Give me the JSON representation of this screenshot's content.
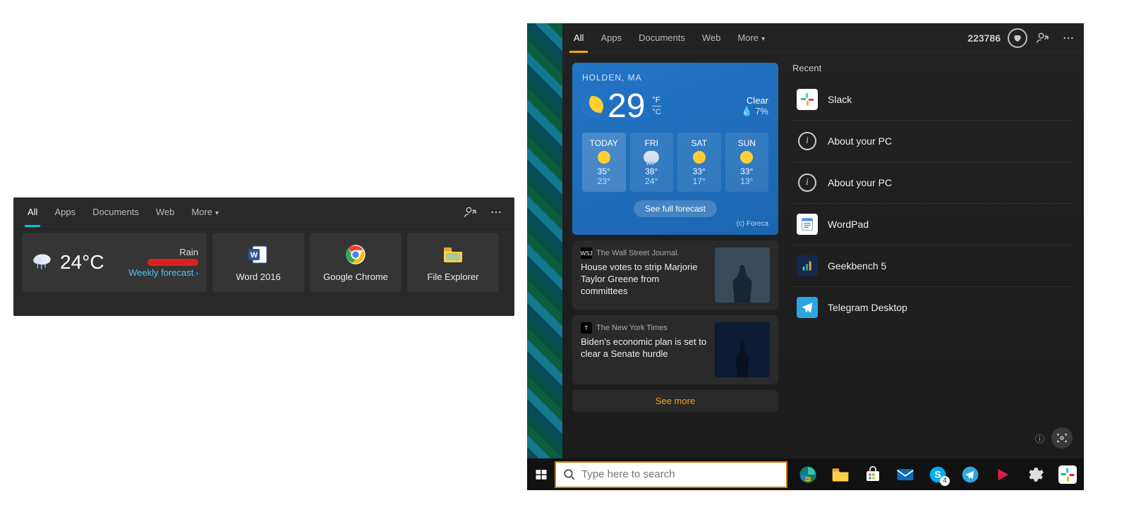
{
  "left": {
    "tabs": [
      "All",
      "Apps",
      "Documents",
      "Web",
      "More"
    ],
    "active_tab": 0,
    "weather": {
      "temp": "24°C",
      "condition": "Rain",
      "link": "Weekly forecast"
    },
    "apps": [
      {
        "name": "Word 2016",
        "key": "word"
      },
      {
        "name": "Google Chrome",
        "key": "chrome"
      },
      {
        "name": "File Explorer",
        "key": "explorer"
      }
    ]
  },
  "right": {
    "tabs": [
      "All",
      "Apps",
      "Documents",
      "Web",
      "More"
    ],
    "active_tab": 0,
    "points": "223786",
    "weather": {
      "location": "HOLDEN, MA",
      "temp": "29",
      "unit_f": "°F",
      "unit_c": "°C",
      "condition": "Clear",
      "humidity": "7%",
      "days": [
        {
          "label": "TODAY",
          "icon": "sun",
          "hi": "35°",
          "lo": "23°"
        },
        {
          "label": "FRI",
          "icon": "cloud",
          "hi": "38°",
          "lo": "24°"
        },
        {
          "label": "SAT",
          "icon": "sun",
          "hi": "33°",
          "lo": "17°"
        },
        {
          "label": "SUN",
          "icon": "sun",
          "hi": "33°",
          "lo": "13°"
        }
      ],
      "button": "See full forecast",
      "credit": "(c) Foreca"
    },
    "news": [
      {
        "source": "The Wall Street Journal.",
        "src_abbr": "WSJ",
        "headline": "House votes to strip Marjorie Taylor Greene from committees"
      },
      {
        "source": "The New York Times",
        "src_abbr": "T",
        "headline": "Biden's economic plan is set to clear a Senate hurdle"
      }
    ],
    "see_more": "See more",
    "recent_title": "Recent",
    "recent": [
      {
        "label": "Slack",
        "icon": "slack"
      },
      {
        "label": "About your PC",
        "icon": "info"
      },
      {
        "label": "About your PC",
        "icon": "info"
      },
      {
        "label": "WordPad",
        "icon": "wordpad"
      },
      {
        "label": "Geekbench 5",
        "icon": "geekbench"
      },
      {
        "label": "Telegram Desktop",
        "icon": "telegram"
      }
    ]
  },
  "taskbar": {
    "search_placeholder": "Type here to search",
    "skype_badge": "4"
  }
}
